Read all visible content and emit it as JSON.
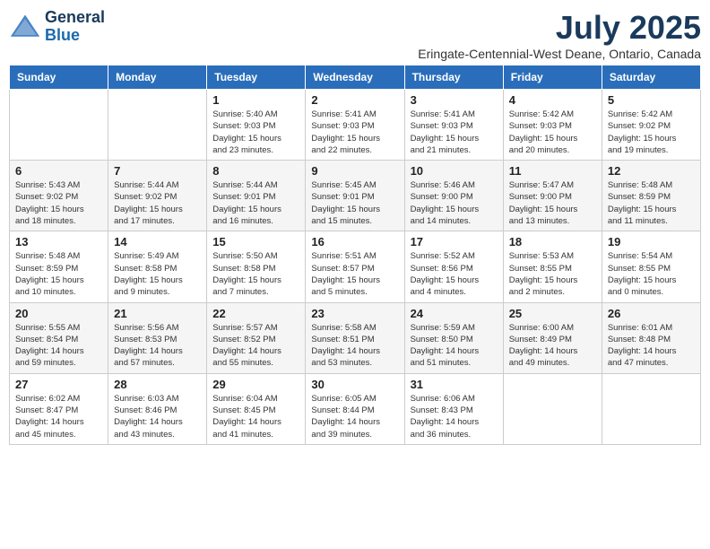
{
  "logo": {
    "line1": "General",
    "line2": "Blue"
  },
  "title": "July 2025",
  "subtitle": "Eringate-Centennial-West Deane, Ontario, Canada",
  "days_of_week": [
    "Sunday",
    "Monday",
    "Tuesday",
    "Wednesday",
    "Thursday",
    "Friday",
    "Saturday"
  ],
  "weeks": [
    [
      {
        "day": "",
        "info": ""
      },
      {
        "day": "",
        "info": ""
      },
      {
        "day": "1",
        "info": "Sunrise: 5:40 AM\nSunset: 9:03 PM\nDaylight: 15 hours\nand 23 minutes."
      },
      {
        "day": "2",
        "info": "Sunrise: 5:41 AM\nSunset: 9:03 PM\nDaylight: 15 hours\nand 22 minutes."
      },
      {
        "day": "3",
        "info": "Sunrise: 5:41 AM\nSunset: 9:03 PM\nDaylight: 15 hours\nand 21 minutes."
      },
      {
        "day": "4",
        "info": "Sunrise: 5:42 AM\nSunset: 9:03 PM\nDaylight: 15 hours\nand 20 minutes."
      },
      {
        "day": "5",
        "info": "Sunrise: 5:42 AM\nSunset: 9:02 PM\nDaylight: 15 hours\nand 19 minutes."
      }
    ],
    [
      {
        "day": "6",
        "info": "Sunrise: 5:43 AM\nSunset: 9:02 PM\nDaylight: 15 hours\nand 18 minutes."
      },
      {
        "day": "7",
        "info": "Sunrise: 5:44 AM\nSunset: 9:02 PM\nDaylight: 15 hours\nand 17 minutes."
      },
      {
        "day": "8",
        "info": "Sunrise: 5:44 AM\nSunset: 9:01 PM\nDaylight: 15 hours\nand 16 minutes."
      },
      {
        "day": "9",
        "info": "Sunrise: 5:45 AM\nSunset: 9:01 PM\nDaylight: 15 hours\nand 15 minutes."
      },
      {
        "day": "10",
        "info": "Sunrise: 5:46 AM\nSunset: 9:00 PM\nDaylight: 15 hours\nand 14 minutes."
      },
      {
        "day": "11",
        "info": "Sunrise: 5:47 AM\nSunset: 9:00 PM\nDaylight: 15 hours\nand 13 minutes."
      },
      {
        "day": "12",
        "info": "Sunrise: 5:48 AM\nSunset: 8:59 PM\nDaylight: 15 hours\nand 11 minutes."
      }
    ],
    [
      {
        "day": "13",
        "info": "Sunrise: 5:48 AM\nSunset: 8:59 PM\nDaylight: 15 hours\nand 10 minutes."
      },
      {
        "day": "14",
        "info": "Sunrise: 5:49 AM\nSunset: 8:58 PM\nDaylight: 15 hours\nand 9 minutes."
      },
      {
        "day": "15",
        "info": "Sunrise: 5:50 AM\nSunset: 8:58 PM\nDaylight: 15 hours\nand 7 minutes."
      },
      {
        "day": "16",
        "info": "Sunrise: 5:51 AM\nSunset: 8:57 PM\nDaylight: 15 hours\nand 5 minutes."
      },
      {
        "day": "17",
        "info": "Sunrise: 5:52 AM\nSunset: 8:56 PM\nDaylight: 15 hours\nand 4 minutes."
      },
      {
        "day": "18",
        "info": "Sunrise: 5:53 AM\nSunset: 8:55 PM\nDaylight: 15 hours\nand 2 minutes."
      },
      {
        "day": "19",
        "info": "Sunrise: 5:54 AM\nSunset: 8:55 PM\nDaylight: 15 hours\nand 0 minutes."
      }
    ],
    [
      {
        "day": "20",
        "info": "Sunrise: 5:55 AM\nSunset: 8:54 PM\nDaylight: 14 hours\nand 59 minutes."
      },
      {
        "day": "21",
        "info": "Sunrise: 5:56 AM\nSunset: 8:53 PM\nDaylight: 14 hours\nand 57 minutes."
      },
      {
        "day": "22",
        "info": "Sunrise: 5:57 AM\nSunset: 8:52 PM\nDaylight: 14 hours\nand 55 minutes."
      },
      {
        "day": "23",
        "info": "Sunrise: 5:58 AM\nSunset: 8:51 PM\nDaylight: 14 hours\nand 53 minutes."
      },
      {
        "day": "24",
        "info": "Sunrise: 5:59 AM\nSunset: 8:50 PM\nDaylight: 14 hours\nand 51 minutes."
      },
      {
        "day": "25",
        "info": "Sunrise: 6:00 AM\nSunset: 8:49 PM\nDaylight: 14 hours\nand 49 minutes."
      },
      {
        "day": "26",
        "info": "Sunrise: 6:01 AM\nSunset: 8:48 PM\nDaylight: 14 hours\nand 47 minutes."
      }
    ],
    [
      {
        "day": "27",
        "info": "Sunrise: 6:02 AM\nSunset: 8:47 PM\nDaylight: 14 hours\nand 45 minutes."
      },
      {
        "day": "28",
        "info": "Sunrise: 6:03 AM\nSunset: 8:46 PM\nDaylight: 14 hours\nand 43 minutes."
      },
      {
        "day": "29",
        "info": "Sunrise: 6:04 AM\nSunset: 8:45 PM\nDaylight: 14 hours\nand 41 minutes."
      },
      {
        "day": "30",
        "info": "Sunrise: 6:05 AM\nSunset: 8:44 PM\nDaylight: 14 hours\nand 39 minutes."
      },
      {
        "day": "31",
        "info": "Sunrise: 6:06 AM\nSunset: 8:43 PM\nDaylight: 14 hours\nand 36 minutes."
      },
      {
        "day": "",
        "info": ""
      },
      {
        "day": "",
        "info": ""
      }
    ]
  ]
}
